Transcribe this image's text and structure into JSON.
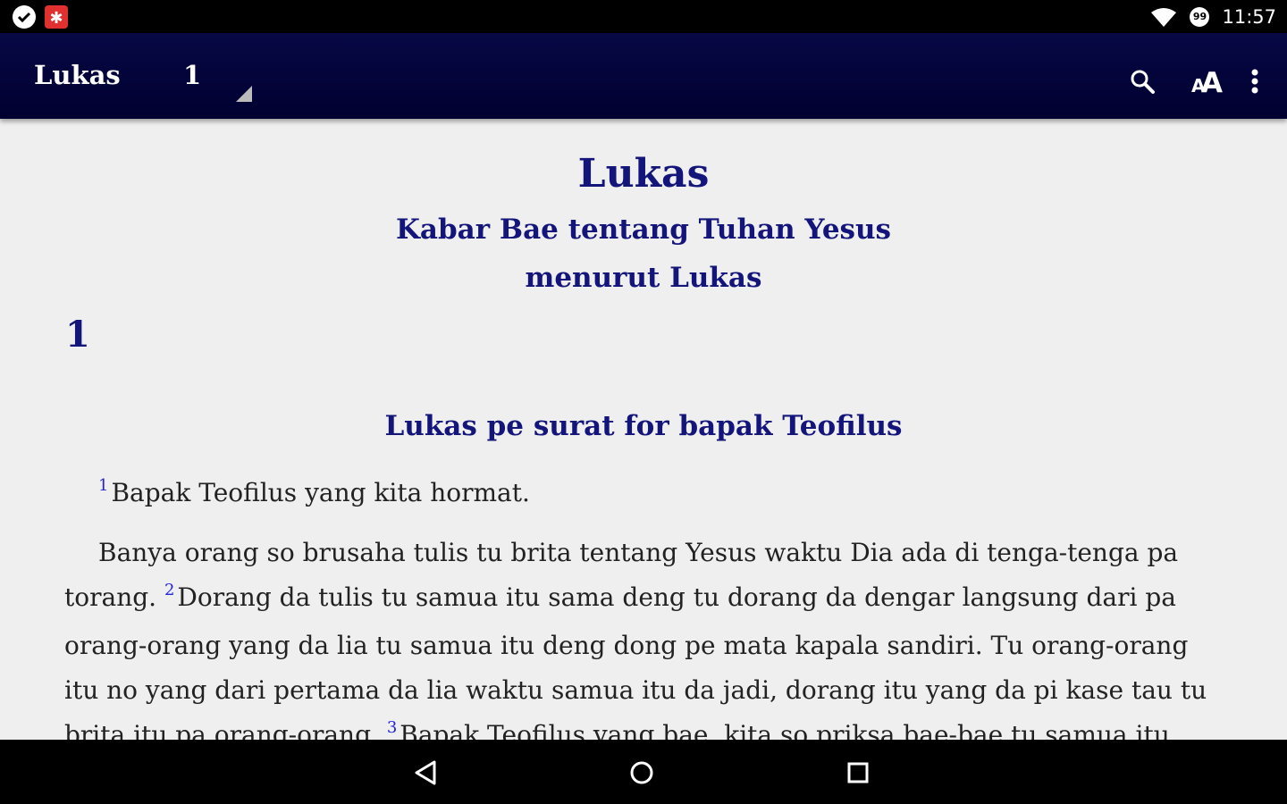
{
  "status_bar": {
    "time": "11:57",
    "notification_badge": "99",
    "icons": [
      "check-circle-icon",
      "app-notification-icon",
      "wifi-icon",
      "data-saver-icon"
    ]
  },
  "toolbar": {
    "book": "Lukas",
    "chapter": "1",
    "actions": [
      "search-icon",
      "text-size-icon",
      "more-options-icon"
    ]
  },
  "reader": {
    "book_title": "Lukas",
    "subtitle_line1": "Kabar Bae tentang Tuhan Yesus",
    "subtitle_line2": "menurut Lukas",
    "chapter_number": "1",
    "section_heading": "Lukas pe surat for bapak Teofilus",
    "verses": {
      "v1_num": "1",
      "v1_text": "Bapak Teofilus yang kita hormat.",
      "p2_text": "Banya orang so brusaha tulis tu brita tentang Yesus waktu Dia ada di tenga-tenga pa torang.",
      "v2_num": "2",
      "v2_text": "Dorang da tulis tu samua itu sama deng tu dorang da dengar langsung dari pa orang-orang yang da lia tu samua itu deng dong pe mata kapala sandiri. Tu orang-orang itu no yang dari pertama da lia waktu samua itu da jadi, dorang itu yang da pi kase tau tu brita itu pa orang-orang.",
      "v3_num": "3",
      "v3_text": "Bapak Teofilus yang bae, kita so priksa bae-bae tu samua itu mulai dari pertama. Abis"
    }
  },
  "colors": {
    "toolbar_bg": "#05063d",
    "heading_text": "#13157a",
    "verse_number": "#2222dd",
    "body_text": "#222222",
    "page_bg": "#efefef"
  }
}
